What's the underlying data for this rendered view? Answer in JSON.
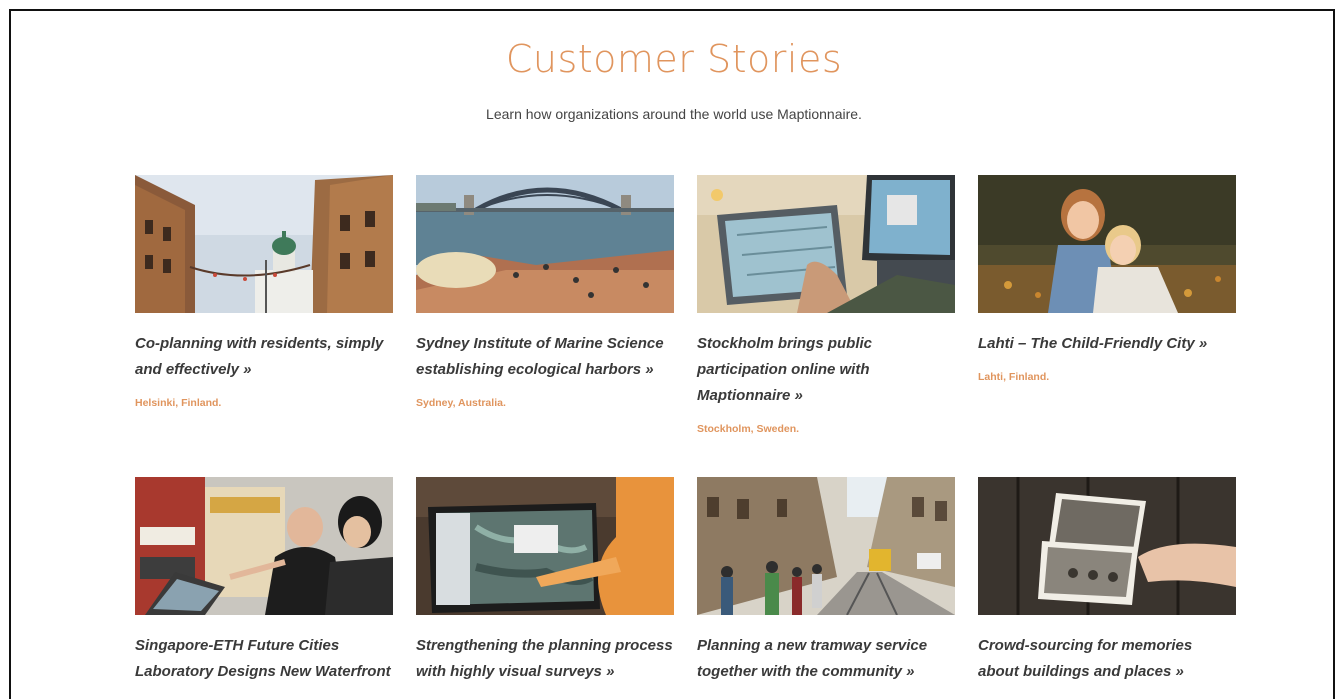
{
  "header": {
    "title": "Customer Stories",
    "subtitle": "Learn how organizations around the world use Maptionnaire."
  },
  "stories": [
    {
      "title": "Co-planning with residents, simply and effectively »",
      "location": "Helsinki, Finland.",
      "image_icon": "helsinki-street-photo"
    },
    {
      "title": "Sydney Institute of Marine Science establishing ecological harbors »",
      "location": "Sydney, Australia.",
      "image_icon": "sydney-harbour-photo"
    },
    {
      "title": "Stockholm brings public participation online with Maptionnaire »",
      "location": "Stockholm, Sweden.",
      "image_icon": "tablet-map-photo"
    },
    {
      "title": "Lahti – The Child-Friendly City »",
      "location": "Lahti, Finland.",
      "image_icon": "children-hugging-photo"
    },
    {
      "title": "Singapore-ETH Future Cities Laboratory Designs New Waterfront",
      "location": "",
      "image_icon": "workshop-laptop-photo"
    },
    {
      "title": "Strengthening the planning process with highly visual surveys »",
      "location": "",
      "image_icon": "touchscreen-map-photo"
    },
    {
      "title": "Planning a new tramway service together with the community »",
      "location": "",
      "image_icon": "tram-street-photo"
    },
    {
      "title": "Crowd-sourcing for memories about buildings and places »",
      "location": "",
      "image_icon": "old-photographs-photo"
    }
  ],
  "colors": {
    "accent": "#e0955e",
    "title_text": "#3a3a3a",
    "body_text": "#444444"
  }
}
